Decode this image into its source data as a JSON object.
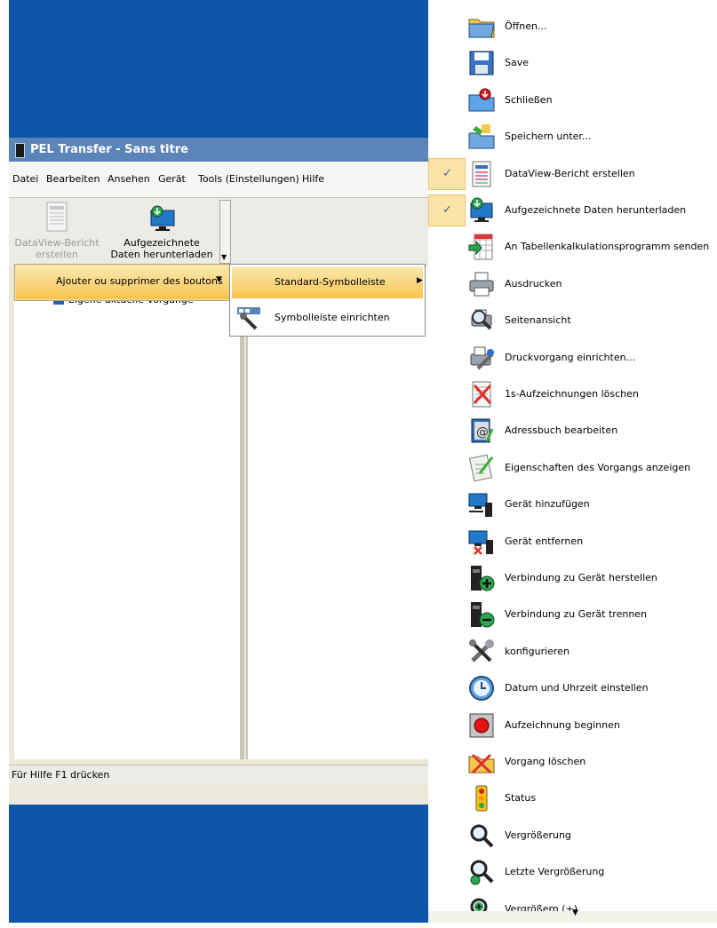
{
  "window": {
    "title": "PEL Transfer - Sans titre",
    "menu": [
      "Datei",
      "Bearbeiten",
      "Ansehen",
      "Gerät",
      "Tools (Einstellungen)",
      "Hilfe"
    ],
    "toolbar": {
      "btn1": "DataView-Bericht erstellen",
      "btn2": "Aufgezeichnete Daten herunterladen"
    },
    "tree_item": "Eigene aktuelle Vorgänge",
    "status": "Für Hilfe F1 drücken"
  },
  "context_menu": {
    "item": "Ajouter ou supprimer des boutons",
    "sub1": "Standard-Symbolleiste",
    "sub2": "Symbolleiste einrichten"
  },
  "commands": [
    {
      "label": "Öffnen...",
      "icon": "folder-open-icon",
      "checked": false
    },
    {
      "label": "Save",
      "icon": "floppy-disk-icon",
      "checked": false
    },
    {
      "label": "Schließen",
      "icon": "folder-close-icon",
      "checked": false
    },
    {
      "label": "Speichern unter...",
      "icon": "folder-save-as-icon",
      "checked": false
    },
    {
      "label": "DataView-Bericht erstellen",
      "icon": "report-icon",
      "checked": true
    },
    {
      "label": "Aufgezeichnete Daten herunterladen",
      "icon": "monitor-download-icon",
      "checked": true
    },
    {
      "label": "An Tabellenkalkulationsprogramm senden",
      "icon": "spreadsheet-icon",
      "checked": false
    },
    {
      "label": "Ausdrucken",
      "icon": "printer-icon",
      "checked": false
    },
    {
      "label": "Seitenansicht",
      "icon": "print-preview-icon",
      "checked": false
    },
    {
      "label": "Druckvorgang einrichten...",
      "icon": "print-setup-icon",
      "checked": false
    },
    {
      "label": "1s-Aufzeichnungen löschen",
      "icon": "delete-records-icon",
      "checked": false
    },
    {
      "label": "Adressbuch bearbeiten",
      "icon": "address-book-icon",
      "checked": false
    },
    {
      "label": "Eigenschaften des Vorgangs anzeigen",
      "icon": "properties-icon",
      "checked": false
    },
    {
      "label": "Gerät hinzufügen",
      "icon": "device-add-icon",
      "checked": false
    },
    {
      "label": "Gerät entfernen",
      "icon": "device-remove-icon",
      "checked": false
    },
    {
      "label": "Verbindung zu Gerät herstellen",
      "icon": "connect-icon",
      "checked": false
    },
    {
      "label": "Verbindung zu Gerät trennen",
      "icon": "disconnect-icon",
      "checked": false
    },
    {
      "label": "konfigurieren",
      "icon": "tools-icon",
      "checked": false
    },
    {
      "label": "Datum und Uhrzeit einstellen",
      "icon": "clock-icon",
      "checked": false
    },
    {
      "label": "Aufzeichnung beginnen",
      "icon": "record-button-icon",
      "checked": false
    },
    {
      "label": "Vorgang löschen",
      "icon": "delete-session-icon",
      "checked": false
    },
    {
      "label": "Status",
      "icon": "traffic-light-icon",
      "checked": false
    },
    {
      "label": "Vergrößerung",
      "icon": "zoom-icon",
      "checked": false
    },
    {
      "label": "Letzte Vergrößerung",
      "icon": "zoom-previous-icon",
      "checked": false
    },
    {
      "label": "Vergrößern (+)",
      "icon": "zoom-in-icon",
      "checked": false
    }
  ],
  "colors": {
    "desktop": "#0e56a8",
    "menu_highlight": "#f6c44e",
    "check_bg": "#fce4a8",
    "check_mark": "#3a5fb3"
  }
}
